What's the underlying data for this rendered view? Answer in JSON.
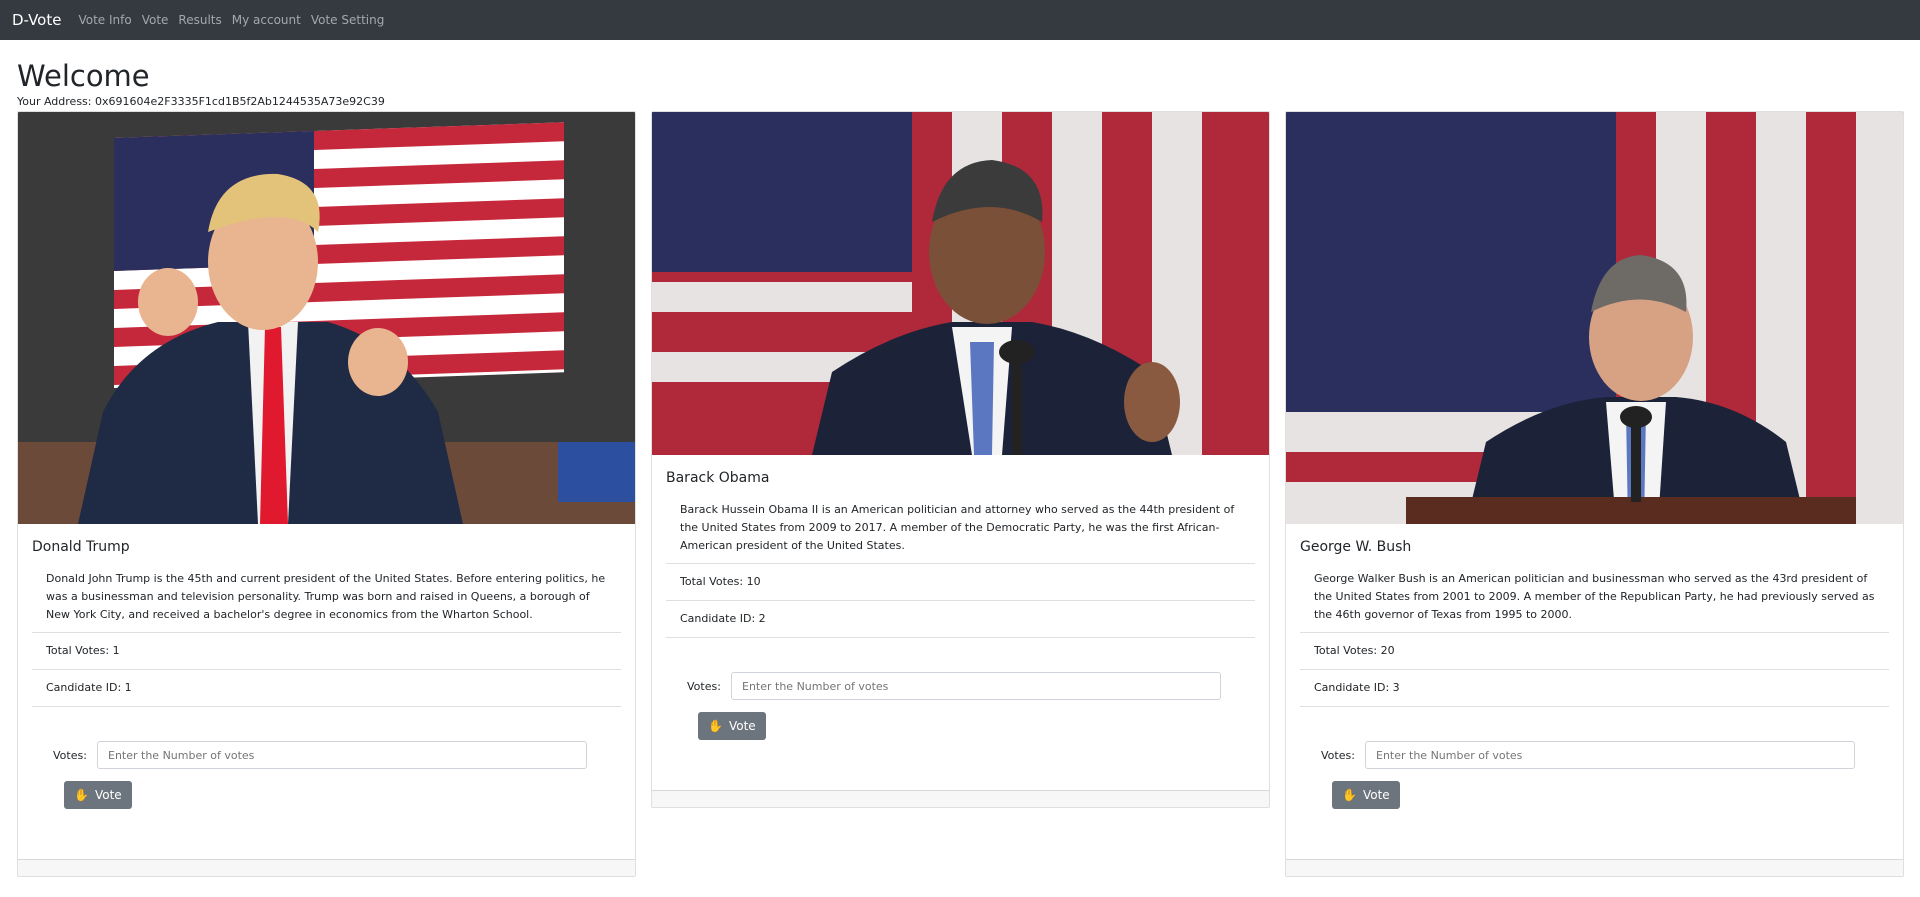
{
  "navbar": {
    "brand": "D-Vote",
    "links": [
      "Vote Info",
      "Vote",
      "Results",
      "My account",
      "Vote Setting"
    ]
  },
  "header": {
    "title": "Welcome",
    "address_label": "Your Address:",
    "address_value": "0x691604e2F3335F1cd1B5f2Ab1244535A73e92C39"
  },
  "vote_form": {
    "label": "Votes:",
    "placeholder": "Enter the Number of votes",
    "button_label": "Vote"
  },
  "candidates": [
    {
      "name": "Donald Trump",
      "description": "Donald John Trump is the 45th and current president of the United States. Before entering politics, he was a businessman and television personality. Trump was born and raised in Queens, a borough of New York City, and received a bachelor's degree in economics from the Wharton School.",
      "total_votes": "Total Votes: 1",
      "candidate_id": "Candidate ID: 1"
    },
    {
      "name": "Barack Obama",
      "description": "Barack Hussein Obama II is an American politician and attorney who served as the 44th president of the United States from 2009 to 2017. A member of the Democratic Party, he was the first African-American president of the United States.",
      "total_votes": "Total Votes: 10",
      "candidate_id": "Candidate ID: 2"
    },
    {
      "name": "George W. Bush",
      "description": "George Walker Bush is an American politician and businessman who served as the 43rd president of the United States from 2001 to 2009. A member of the Republican Party, he had previously served as the 46th governor of Texas from 1995 to 2000.",
      "total_votes": "Total Votes: 20",
      "candidate_id": "Candidate ID: 3"
    }
  ],
  "colors": {
    "navbar_bg": "#343a40",
    "button_bg": "#6c757d",
    "flag_red": "#b22234",
    "flag_blue": "#2b2f5e"
  }
}
